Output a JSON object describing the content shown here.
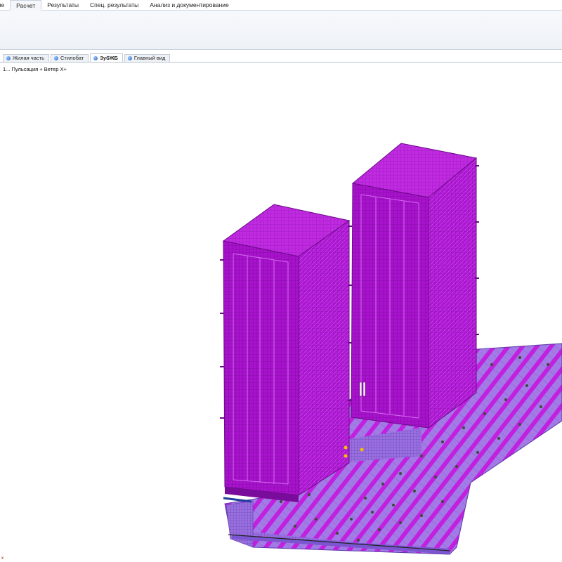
{
  "ribbon": {
    "tabs": [
      {
        "label": "ние",
        "active": false
      },
      {
        "label": "Расчет",
        "active": true
      },
      {
        "label": "Результаты",
        "active": false
      },
      {
        "label": "Спец. результаты",
        "active": false
      },
      {
        "label": "Анализ и документирование",
        "active": false
      }
    ]
  },
  "doc_tabs": [
    {
      "label": "Жилая часть",
      "active": false,
      "icon": "model-icon"
    },
    {
      "label": "Стилобат",
      "active": false,
      "icon": "model-icon"
    },
    {
      "label": "ЗубЖБ",
      "active": true,
      "icon": "model-icon"
    },
    {
      "label": "Главный вид",
      "active": false,
      "icon": "model-icon"
    }
  ],
  "viewport": {
    "load_case_label": "1... Пульсация + Ветер X+",
    "axis_label": "x",
    "colors": {
      "mesh_fill": "#b11ad6",
      "mesh_fill_dark": "#8e0fb0",
      "mesh_line": "#6a0a88",
      "slab_fill": "#a27be6",
      "slab_stripe": "#c41ee0",
      "support_dot": "#3c4a3c"
    }
  }
}
